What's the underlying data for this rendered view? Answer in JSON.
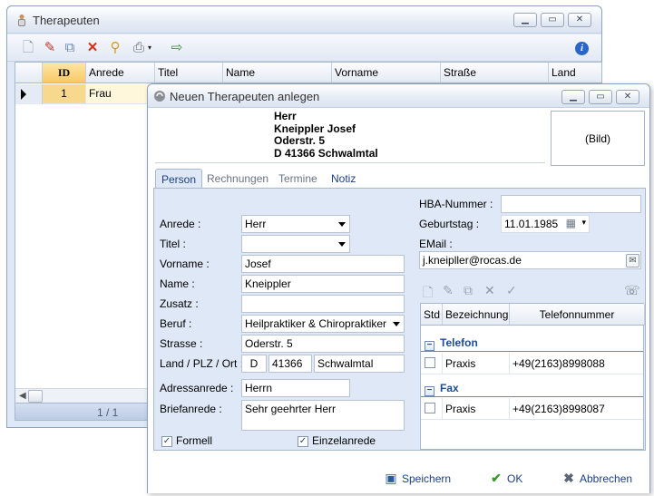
{
  "main_window": {
    "title": "Therapeuten",
    "toolbar_icons": [
      "new-icon",
      "edit-icon",
      "copy-icon",
      "delete-icon",
      "search-icon",
      "print-icon",
      "export-icon",
      "info-icon"
    ],
    "columns": [
      "ID",
      "Anrede",
      "Titel",
      "Name",
      "Vorname",
      "Straße",
      "Land"
    ],
    "rows": [
      {
        "id": "1",
        "anrede": "Frau",
        "titel": "",
        "name": "",
        "vorname": "",
        "strasse": "",
        "land": ""
      }
    ],
    "pager": "1 / 1"
  },
  "dialog": {
    "title": "Neuen Therapeuten anlegen",
    "address_lines": [
      "Herr",
      "Kneippler Josef",
      "Oderstr. 5",
      "D 41366 Schwalmtal"
    ],
    "picture_label": "(Bild)",
    "tabs": [
      "Person",
      "Rechnungen",
      "Termine",
      "Notiz"
    ],
    "active_tab": "Person",
    "form": {
      "anrede_label": "Anrede :",
      "anrede_value": "Herr",
      "titel_label": "Titel :",
      "titel_value": "",
      "vorname_label": "Vorname :",
      "vorname_value": "Josef",
      "name_label": "Name :",
      "name_value": "Kneippler",
      "zusatz_label": "Zusatz :",
      "zusatz_value": "",
      "beruf_label": "Beruf :",
      "beruf_value": "Heilpraktiker & Chiropraktiker",
      "strasse_label": "Strasse :",
      "strasse_value": "Oderstr. 5",
      "land_plz_ort_label": "Land / PLZ / Ort :",
      "land_value": "D",
      "plz_value": "41366",
      "ort_value": "Schwalmtal",
      "adressanrede_label": "Adressanrede :",
      "adressanrede_value": "Herrn",
      "briefanrede_label": "Briefanrede :",
      "briefanrede_value": "Sehr geehrter Herr",
      "formell_label": "Formell",
      "formell_checked": true,
      "einzelanrede_label": "Einzelanrede",
      "einzelanrede_checked": true,
      "hba_label": "HBA-Nummer :",
      "hba_value": "",
      "geburtstag_label": "Geburtstag :",
      "geburtstag_value": "11.01.1985",
      "email_label": "EMail :",
      "email_value": "j.kneipller@rocas.de"
    },
    "phone_table": {
      "columns": [
        "Std",
        "Bezeichnung",
        "Telefonnummer"
      ],
      "groups": [
        {
          "name": "Telefon",
          "rows": [
            {
              "bezeichnung": "Praxis",
              "nummer": "+49(2163)8998088"
            }
          ]
        },
        {
          "name": "Fax",
          "rows": [
            {
              "bezeichnung": "Praxis",
              "nummer": "+49(2163)8998087"
            }
          ]
        }
      ]
    },
    "buttons": {
      "save": "Speichern",
      "ok": "OK",
      "cancel": "Abbrechen"
    }
  }
}
